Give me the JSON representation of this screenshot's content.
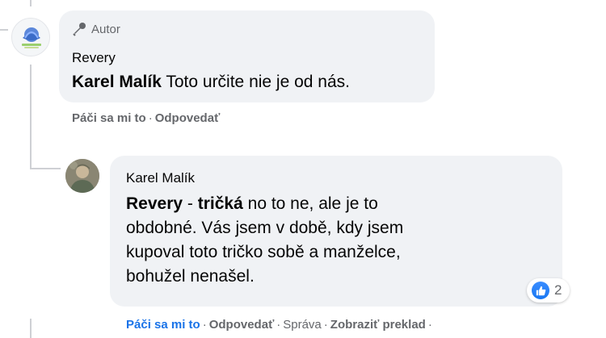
{
  "comment1": {
    "badge": "Autor",
    "author": "Revery",
    "mention": "Karel Malík",
    "text": "Toto určite nie je od nás.",
    "actions": {
      "like": "Páči sa mi to",
      "reply": "Odpovedať"
    }
  },
  "comment2": {
    "author": "Karel Malík",
    "mention1": "Revery",
    "dash": "-",
    "mention2": "tričká",
    "line1_rest": "no to ne, ale je to",
    "line2": "obdobné. Vás jsem v době, kdy jsem",
    "line3": "kupoval toto tričko sobě a manželce,",
    "line4": "bohužel nenašel.",
    "reaction_count": "2",
    "reaction_icon": "thumbs-up-icon",
    "actions": {
      "like": "Páči sa mi to",
      "reply": "Odpovedať",
      "message": "Správa",
      "translate": "Zobraziť preklad"
    }
  },
  "colors": {
    "bubble": "#f0f2f5",
    "secondary_text": "#65676b",
    "liked": "#1a73e8",
    "reaction_blue": "#1877f2"
  }
}
